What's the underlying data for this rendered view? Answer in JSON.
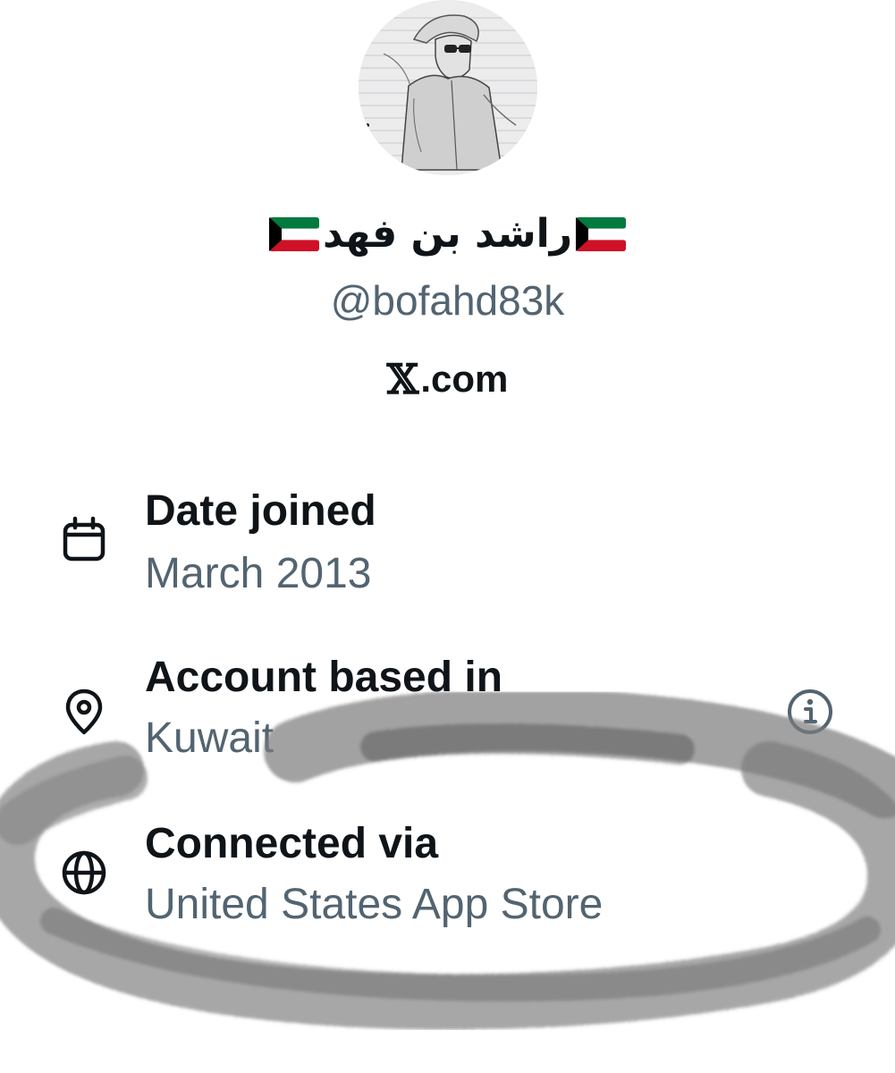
{
  "profile": {
    "display_name": "راشد بن فهد",
    "handle": "@bofahd83k",
    "site_logo": "𝕏",
    "site_text": ".com",
    "flag_icon": "kuwait-flag-icon"
  },
  "about": {
    "rows": [
      {
        "icon": "calendar-icon",
        "label": "Date joined",
        "value": "March 2013"
      },
      {
        "icon": "location-pin-icon",
        "label": "Account based in",
        "value": "Kuwait"
      },
      {
        "icon": "globe-icon",
        "label": "Connected via",
        "value": "United States App Store"
      }
    ],
    "info_button_icon": "info-circle-icon"
  },
  "colors": {
    "primary_text": "#0f1419",
    "secondary_text": "#536471",
    "flag_green": "#007a3d",
    "flag_red": "#ce1126",
    "flag_black": "#000000",
    "scribble": "#7a7a7a"
  }
}
